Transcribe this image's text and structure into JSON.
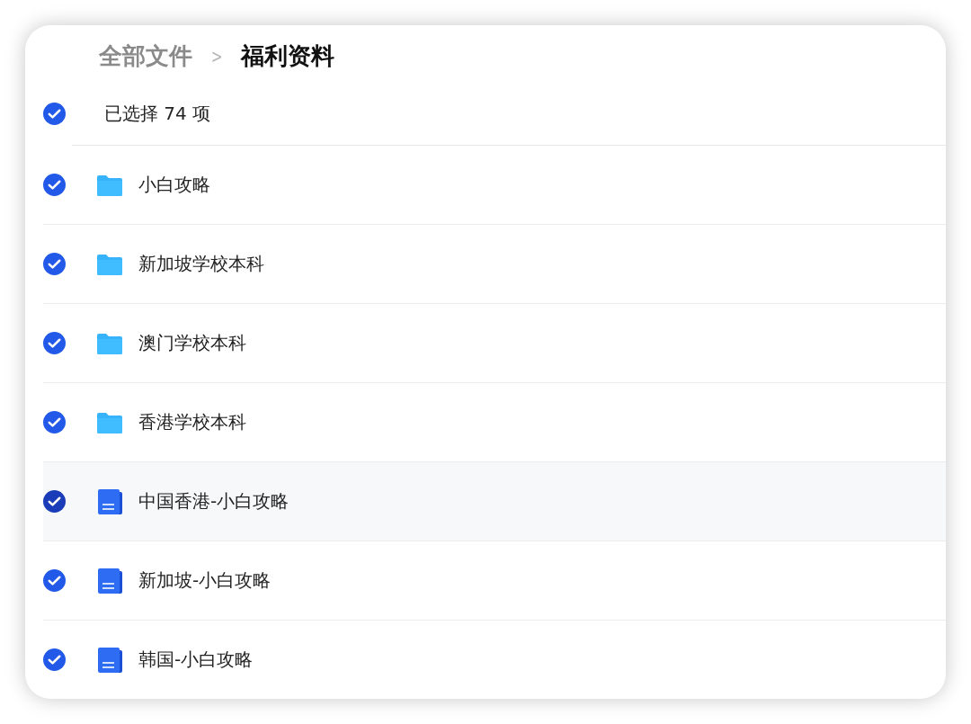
{
  "breadcrumb": [
    {
      "label": "全部文件",
      "current": false
    },
    {
      "label": "福利资料",
      "current": true
    }
  ],
  "breadcrumb_separator": ">",
  "selection": {
    "checked": true,
    "label": "已选择 74 项"
  },
  "files": [
    {
      "name": "小白攻略",
      "kind": "folder",
      "checked": true,
      "highlighted": false
    },
    {
      "name": "新加坡学校本科",
      "kind": "folder",
      "checked": true,
      "highlighted": false
    },
    {
      "name": "澳门学校本科",
      "kind": "folder",
      "checked": true,
      "highlighted": false
    },
    {
      "name": "香港学校本科",
      "kind": "folder",
      "checked": true,
      "highlighted": false
    },
    {
      "name": "中国香港-小白攻略",
      "kind": "doc",
      "checked": true,
      "highlighted": true
    },
    {
      "name": "新加坡-小白攻略",
      "kind": "doc",
      "checked": true,
      "highlighted": false
    },
    {
      "name": "韩国-小白攻略",
      "kind": "doc",
      "checked": true,
      "highlighted": false
    }
  ]
}
